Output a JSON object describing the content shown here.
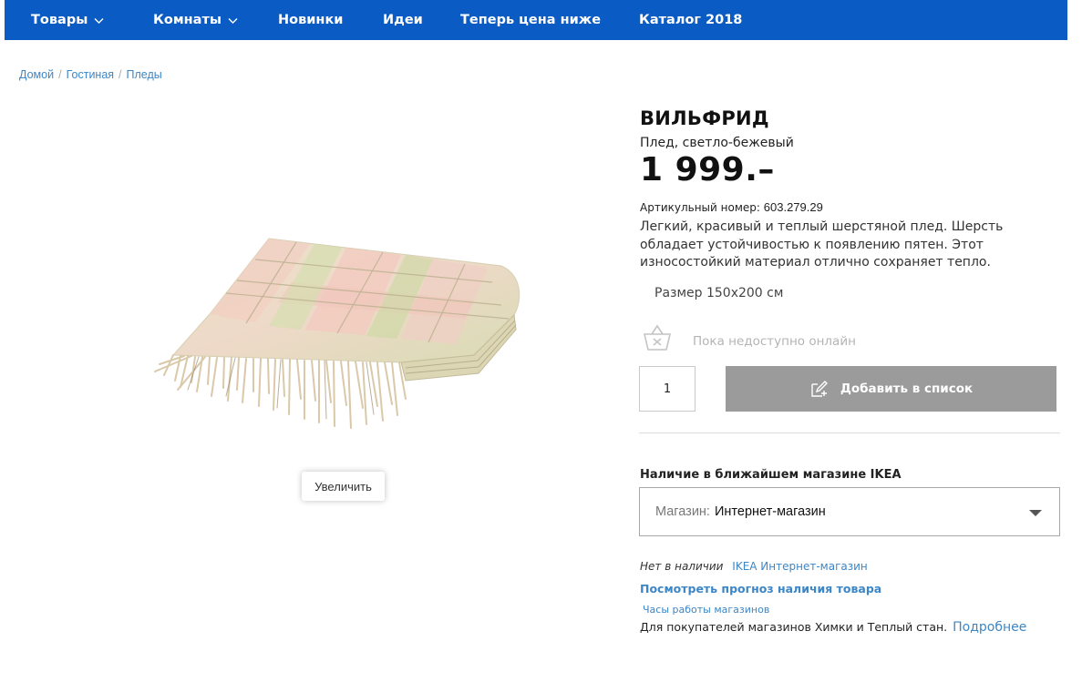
{
  "nav": {
    "items": [
      {
        "label": "Товары",
        "has_dropdown": true
      },
      {
        "label": "Комнаты",
        "has_dropdown": true
      },
      {
        "label": "Новинки",
        "has_dropdown": false
      },
      {
        "label": "Идеи",
        "has_dropdown": false
      },
      {
        "label": "Теперь цена ниже",
        "has_dropdown": false
      },
      {
        "label": "Каталог 2018",
        "has_dropdown": false
      }
    ],
    "background_color": "#0a5bc4"
  },
  "breadcrumb": {
    "items": [
      "Домой",
      "Гостиная",
      "Пледы"
    ],
    "separator": "/"
  },
  "product": {
    "name": "ВИЛЬФРИД",
    "subtitle": "Плед, светло-бежевый",
    "price": "1 999.–",
    "article_label": "Артикульный номер:",
    "article_number": "603.279.29",
    "description": "Легкий, красивый и теплый шерстяной плед. Шерсть обладает устойчивостью к появлению пятен. Этот износостойкий материал отлично сохраняет тепло.",
    "size": "Размер 150x200 см",
    "zoom_label": "Увеличить"
  },
  "purchase": {
    "unavailable_icon": "basket-crossed-icon",
    "unavailable_text": "Пока недоступно онлайн",
    "quantity": "1",
    "add_to_list_label": "Добавить в список",
    "add_icon": "edit-list-icon",
    "button_color": "#9b9b9b"
  },
  "store": {
    "heading": "Наличие в ближайшем магазине IKEA",
    "select_label": "Магазин:",
    "select_value": "Интернет-магазин",
    "stock_status": "Нет в наличии",
    "stock_store": "IKEA Интернет-магазин",
    "forecast_link": "Посмотреть прогноз наличия товара",
    "hours_link": "Часы работы магазинов",
    "customers_note": "Для покупателей магазинов Химки и Теплый стан.",
    "more_link": "Подробнее"
  }
}
